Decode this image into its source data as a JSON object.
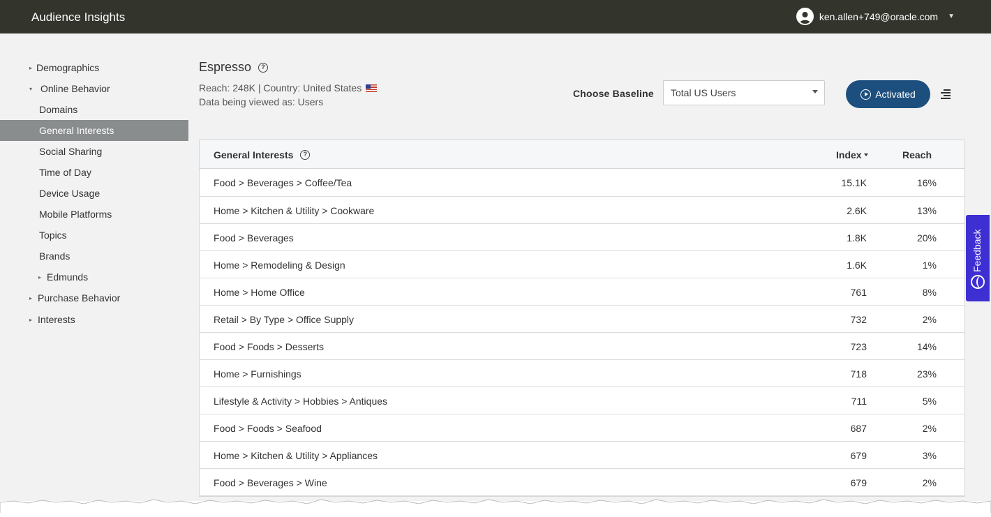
{
  "header": {
    "app_title": "Audience Insights",
    "user_email": "ken.allen+749@oracle.com"
  },
  "sidebar": {
    "items": [
      {
        "label": "Demographics",
        "expander": "▸"
      },
      {
        "label": "Online Behavior",
        "expander": "▾"
      },
      {
        "label": "Domains"
      },
      {
        "label": "General Interests",
        "active": true
      },
      {
        "label": "Social Sharing"
      },
      {
        "label": "Time of Day"
      },
      {
        "label": "Device Usage"
      },
      {
        "label": "Mobile Platforms"
      },
      {
        "label": "Topics"
      },
      {
        "label": "Brands"
      },
      {
        "label": "Edmunds",
        "expander": "▸"
      },
      {
        "label": "Purchase Behavior",
        "expander": "▸"
      },
      {
        "label": "Interests",
        "expander": "▸"
      }
    ]
  },
  "segment": {
    "title": "Espresso",
    "reach_line": "Reach: 248K | Country: United States",
    "viewed_as": "Data being viewed as: Users"
  },
  "baseline": {
    "label": "Choose Baseline",
    "selected": "Total US Users"
  },
  "activated_label": "Activated",
  "table": {
    "headers": {
      "name": "General Interests",
      "index": "Index",
      "reach": "Reach"
    },
    "rows": [
      {
        "name": "Food > Beverages > Coffee/Tea",
        "index": "15.1K",
        "reach": "16%"
      },
      {
        "name": "Home > Kitchen & Utility > Cookware",
        "index": "2.6K",
        "reach": "13%"
      },
      {
        "name": "Food > Beverages",
        "index": "1.8K",
        "reach": "20%"
      },
      {
        "name": "Home > Remodeling & Design",
        "index": "1.6K",
        "reach": "1%"
      },
      {
        "name": "Home > Home Office",
        "index": "761",
        "reach": "8%"
      },
      {
        "name": "Retail > By Type > Office Supply",
        "index": "732",
        "reach": "2%"
      },
      {
        "name": "Food > Foods > Desserts",
        "index": "723",
        "reach": "14%"
      },
      {
        "name": "Home > Furnishings",
        "index": "718",
        "reach": "23%"
      },
      {
        "name": "Lifestyle & Activity > Hobbies > Antiques",
        "index": "711",
        "reach": "5%"
      },
      {
        "name": "Food > Foods > Seafood",
        "index": "687",
        "reach": "2%"
      },
      {
        "name": "Home > Kitchen & Utility > Appliances",
        "index": "679",
        "reach": "3%"
      },
      {
        "name": "Food > Beverages > Wine",
        "index": "679",
        "reach": "2%"
      }
    ]
  },
  "feedback_label": "Feedback",
  "colors": {
    "topbar": "#33342c",
    "active_nav": "#8a8d8e",
    "activated_button": "#1d4f7e",
    "feedback_tab": "#3e2fd2"
  }
}
